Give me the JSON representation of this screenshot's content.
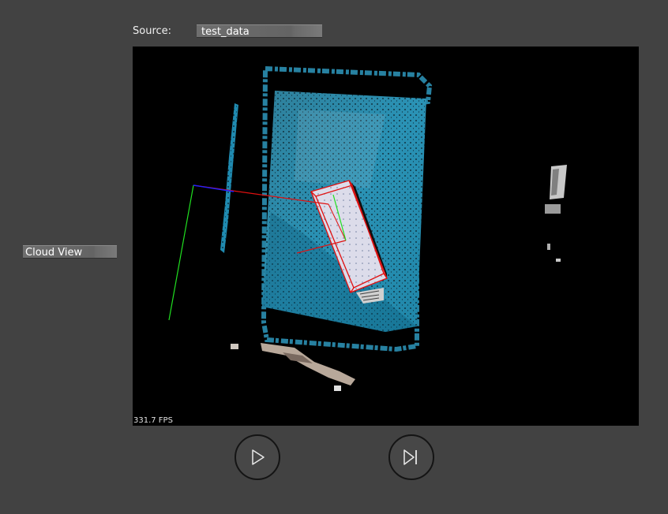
{
  "source": {
    "label": "Source:",
    "value": "test_data"
  },
  "view_select": {
    "value": "Cloud View"
  },
  "viewport": {
    "fps_text": "331.7 FPS",
    "background": "#000000"
  },
  "controls": {
    "play_icon": "play-icon",
    "step_icon": "step-forward-icon"
  },
  "colors": {
    "background": "#424242",
    "point_cloud": "#2a8fb0",
    "bounding_box": "#e01010",
    "axis_x": "#ff2020",
    "axis_y": "#20e020",
    "axis_z": "#2020ff"
  }
}
